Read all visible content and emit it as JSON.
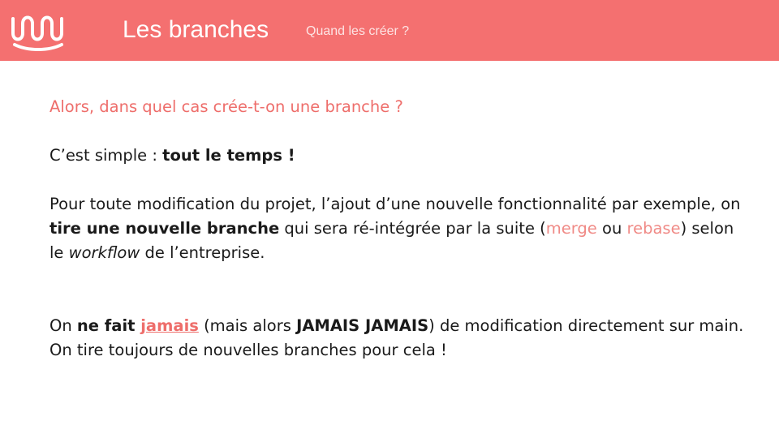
{
  "header": {
    "logo_icon": "wave-logo-icon",
    "title": "Les branches",
    "subtitle": "Quand les créer ?",
    "color": "#f47070"
  },
  "content": {
    "question": "Alors, dans quel cas crée-t-on une branche ?",
    "simple": {
      "prefix": "C’est simple : ",
      "bold": "tout le temps !"
    },
    "modification": {
      "part1": "Pour toute modification du projet, l’ajout d’une nouvelle fonctionnalité par exemple, on ",
      "bold": "tire une nouvelle branche",
      "part2": " qui sera ré-intégrée par la suite (",
      "merge": "merge",
      "between": " ou ",
      "rebase": "rebase",
      "part3": ") selon le ",
      "workflow": "workflow",
      "part4": " de l’entreprise."
    },
    "jamais": {
      "on": "On ",
      "bold1": "ne fait ",
      "jamais": "jamais",
      "part1": " (mais alors ",
      "bold2": "JAMAIS JAMAIS",
      "part2": ") de modification directement sur main. On tire toujours de nouvelles branches pour cela !"
    }
  }
}
